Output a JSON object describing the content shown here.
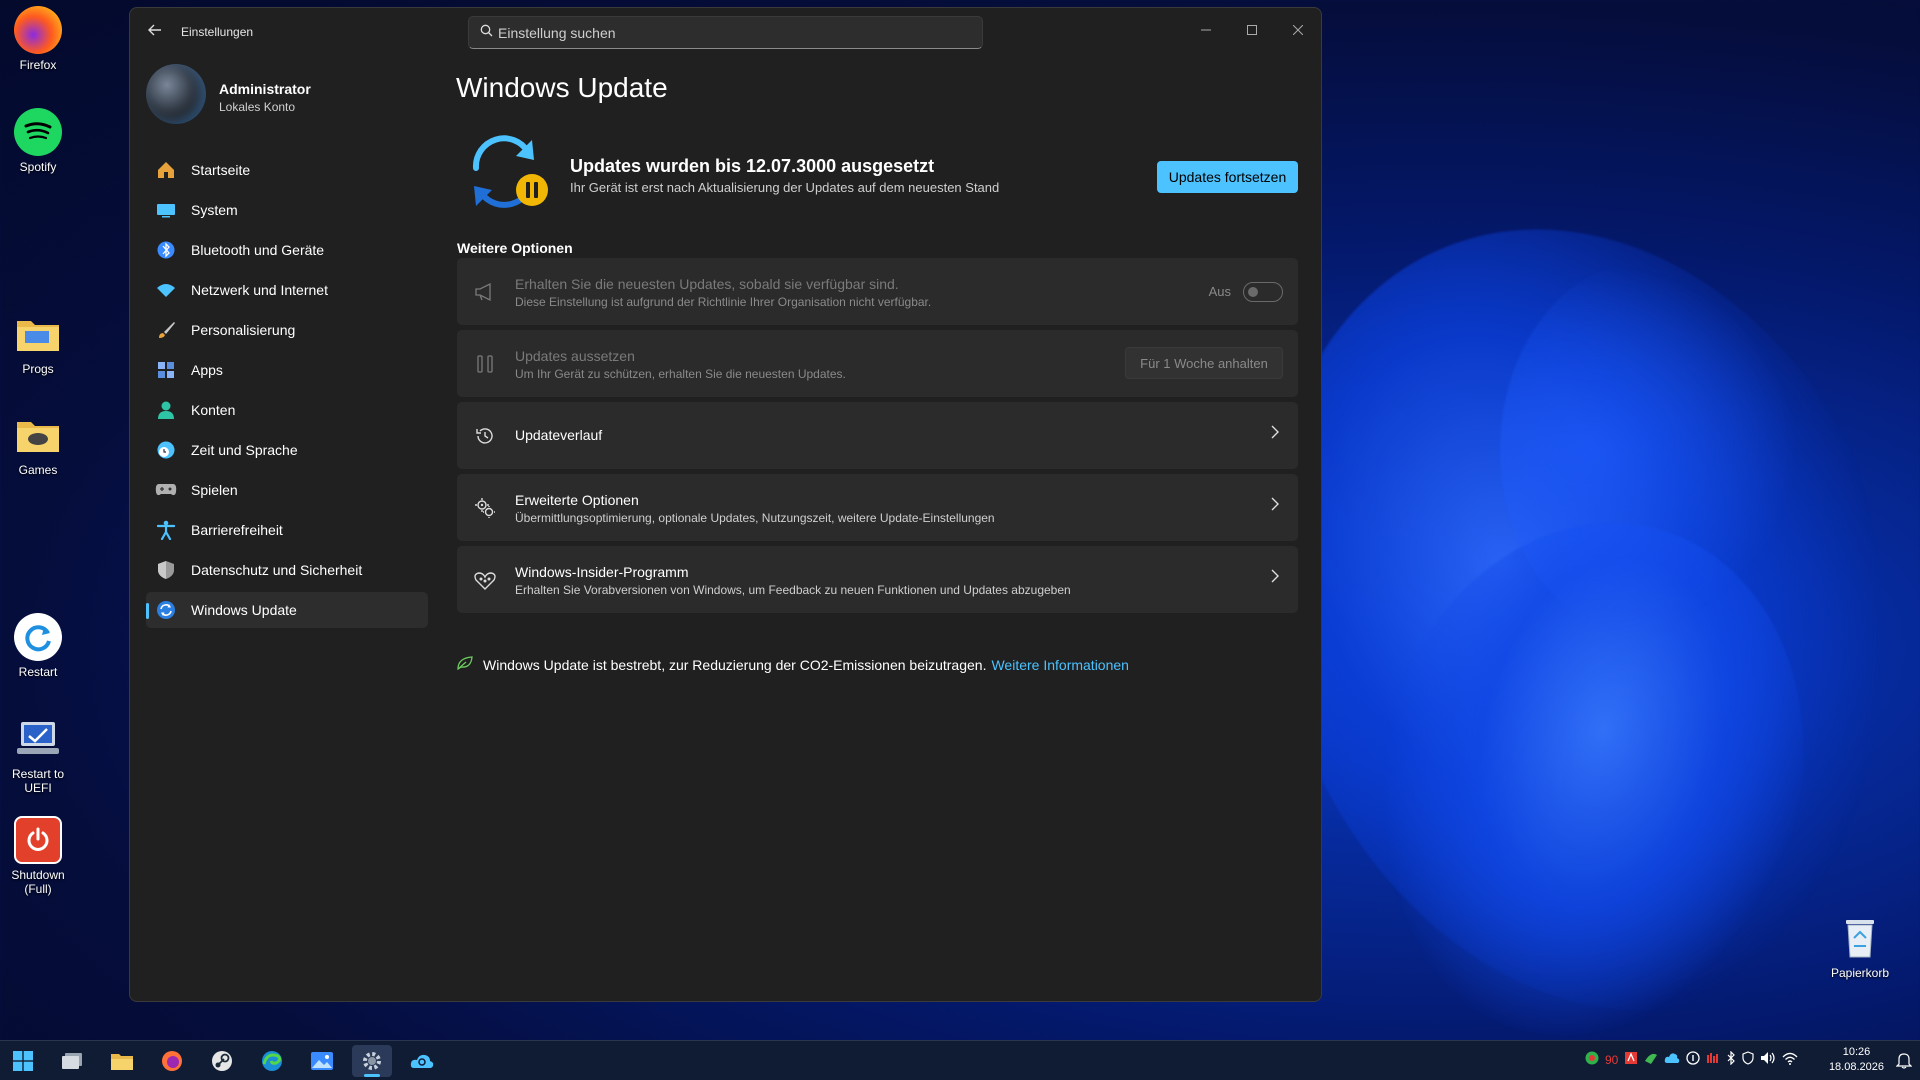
{
  "desktop": {
    "icons": [
      {
        "label": "Firefox",
        "icon": "firefox-icon"
      },
      {
        "label": "Spotify",
        "icon": "spotify-icon"
      },
      {
        "label": "Progs",
        "icon": "folder-icon"
      },
      {
        "label": "Games",
        "icon": "folder-games-icon"
      },
      {
        "label": "Restart",
        "icon": "restart-icon"
      },
      {
        "label": "Restart to UEFI",
        "icon": "uefi-icon"
      },
      {
        "label": "Shutdown (Full)",
        "icon": "power-icon"
      },
      {
        "label": "Papierkorb",
        "icon": "recycle-bin-icon"
      }
    ]
  },
  "window": {
    "app_title": "Einstellungen",
    "search_placeholder": "Einstellung suchen"
  },
  "profile": {
    "name": "Administrator",
    "account_type": "Lokales Konto"
  },
  "sidebar": {
    "items": [
      {
        "label": "Startseite",
        "icon": "home-icon",
        "color": "#e8a23c"
      },
      {
        "label": "System",
        "icon": "monitor-icon",
        "color": "#4cc2ff"
      },
      {
        "label": "Bluetooth und Geräte",
        "icon": "bluetooth-icon",
        "color": "#3a8bff"
      },
      {
        "label": "Netzwerk und Internet",
        "icon": "wifi-icon",
        "color": "#4cc2ff"
      },
      {
        "label": "Personalisierung",
        "icon": "brush-icon",
        "color": "#e8a23c"
      },
      {
        "label": "Apps",
        "icon": "apps-icon",
        "color": "#8ab4f8"
      },
      {
        "label": "Konten",
        "icon": "account-icon",
        "color": "#2ec4a6"
      },
      {
        "label": "Zeit und Sprache",
        "icon": "globe-clock-icon",
        "color": "#4cc2ff"
      },
      {
        "label": "Spielen",
        "icon": "gamepad-icon",
        "color": "#b0b0b0"
      },
      {
        "label": "Barrierefreiheit",
        "icon": "accessibility-icon",
        "color": "#4cc2ff"
      },
      {
        "label": "Datenschutz und Sicherheit",
        "icon": "shield-icon",
        "color": "#9a9a9a"
      },
      {
        "label": "Windows Update",
        "icon": "windows-update-icon",
        "color": "#4cc2ff"
      }
    ],
    "active": "Windows Update"
  },
  "main": {
    "page_title": "Windows Update",
    "status": {
      "title": "Updates wurden bis 12.07.3000 ausgesetzt",
      "subtitle": "Ihr Gerät ist erst nach Aktualisierung der Updates auf dem neuesten Stand",
      "button": "Updates fortsetzen"
    },
    "section_title": "Weitere Optionen",
    "options": [
      {
        "title": "Erhalten Sie die neuesten Updates, sobald sie verfügbar sind.",
        "subtitle": "Diese Einstellung ist aufgrund der Richtlinie Ihrer Organisation nicht verfügbar.",
        "icon": "megaphone-icon",
        "control": "toggle",
        "toggle_label": "Aus",
        "enabled": false
      },
      {
        "title": "Updates aussetzen",
        "subtitle": "Um Ihr Gerät zu schützen, erhalten Sie die neuesten Updates.",
        "icon": "pause-icon",
        "control": "button",
        "button_label": "Für 1 Woche anhalten",
        "enabled": false
      },
      {
        "title": "Updateverlauf",
        "subtitle": "",
        "icon": "history-icon",
        "control": "chevron",
        "enabled": true
      },
      {
        "title": "Erweiterte Optionen",
        "subtitle": "Übermittlungsoptimierung, optionale Updates, Nutzungszeit, weitere Update-Einstellungen",
        "icon": "gears-icon",
        "control": "chevron",
        "enabled": true
      },
      {
        "title": "Windows-Insider-Programm",
        "subtitle": "Erhalten Sie Vorabversionen von Windows, um Feedback zu neuen Funktionen und Updates abzugeben",
        "icon": "insider-icon",
        "control": "chevron",
        "enabled": true
      }
    ],
    "eco_text": "Windows Update ist bestrebt, zur Reduzierung der CO2-Emissionen beizutragen.",
    "eco_link": "Weitere Informationen"
  },
  "taskbar": {
    "apps": [
      "start-icon",
      "task-view-icon",
      "file-explorer-icon",
      "firefox-icon",
      "steam-icon",
      "edge-icon",
      "photos-icon",
      "settings-icon",
      "onedrive-icon"
    ],
    "active_app": "settings-icon",
    "tray_count": "90",
    "time": "10:26",
    "date": "18.08.2026"
  },
  "colors": {
    "accent": "#4cc2ff",
    "window_bg": "#202020",
    "card_bg": "#2b2b2b",
    "pause_badge": "#f2b705"
  }
}
